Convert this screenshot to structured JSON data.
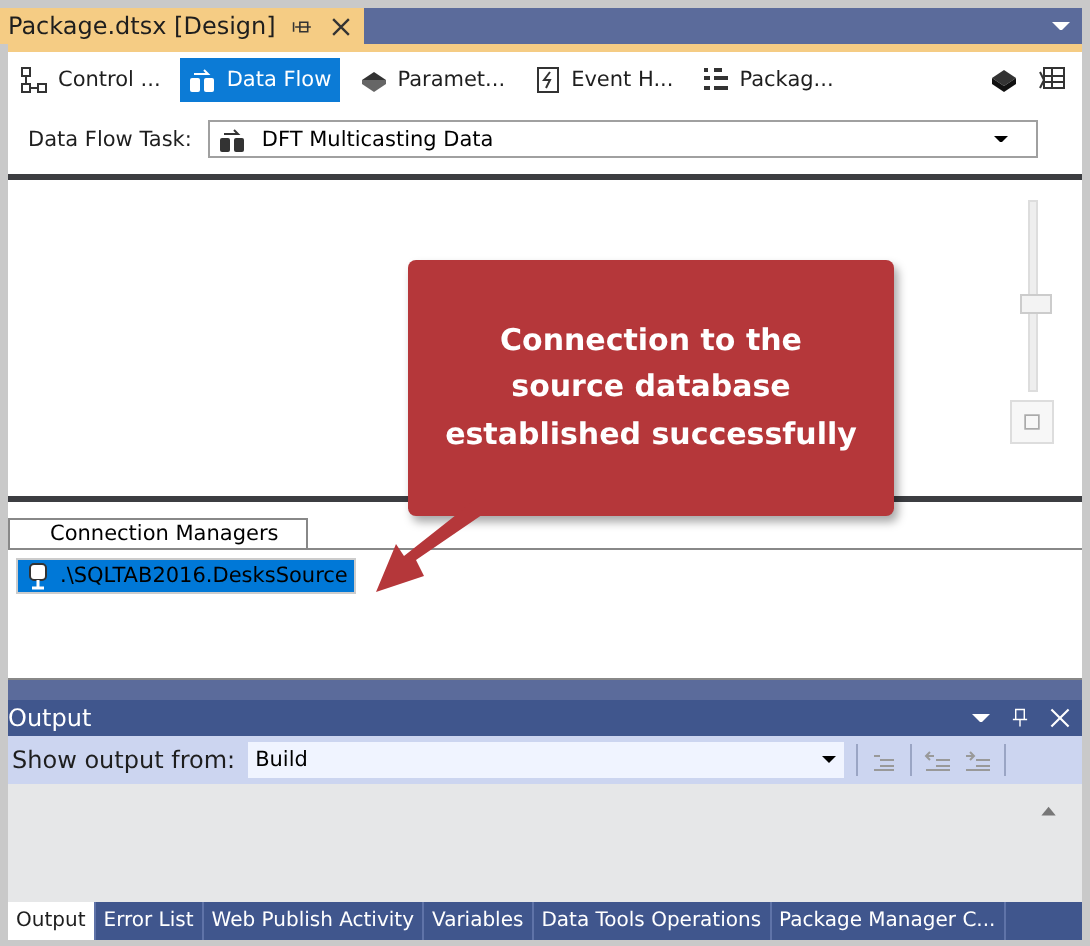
{
  "document_tab": {
    "title": "Package.dtsx [Design]",
    "selected": true
  },
  "designer_tabs": [
    {
      "label": "Control ...",
      "kind": "control",
      "selected": false
    },
    {
      "label": "Data Flow",
      "kind": "dataflow",
      "selected": true
    },
    {
      "label": "Paramet...",
      "kind": "parameters",
      "selected": false
    },
    {
      "label": "Event H...",
      "kind": "events",
      "selected": false
    },
    {
      "label": "Packag...",
      "kind": "explorer",
      "selected": false
    }
  ],
  "data_flow_task": {
    "label": "Data Flow Task:",
    "value": "DFT Multicasting Data"
  },
  "zoom_slider": {
    "level": 0.47
  },
  "callout": {
    "text": "Connection to the source database established successfully"
  },
  "connection_managers": {
    "tab": "Connection Managers",
    "items": [
      {
        "name": ".\\SQLTAB2016.DesksSource",
        "selected": true
      }
    ]
  },
  "output": {
    "title": "Output",
    "show_from_label": "Show output from:",
    "source": "Build",
    "tabs": [
      {
        "label": "Output",
        "selected": true
      },
      {
        "label": "Error List",
        "selected": false
      },
      {
        "label": "Web Publish Activity",
        "selected": false
      },
      {
        "label": "Variables",
        "selected": false
      },
      {
        "label": "Data Tools Operations",
        "selected": false
      },
      {
        "label": "Package Manager C...",
        "selected": false
      }
    ]
  }
}
